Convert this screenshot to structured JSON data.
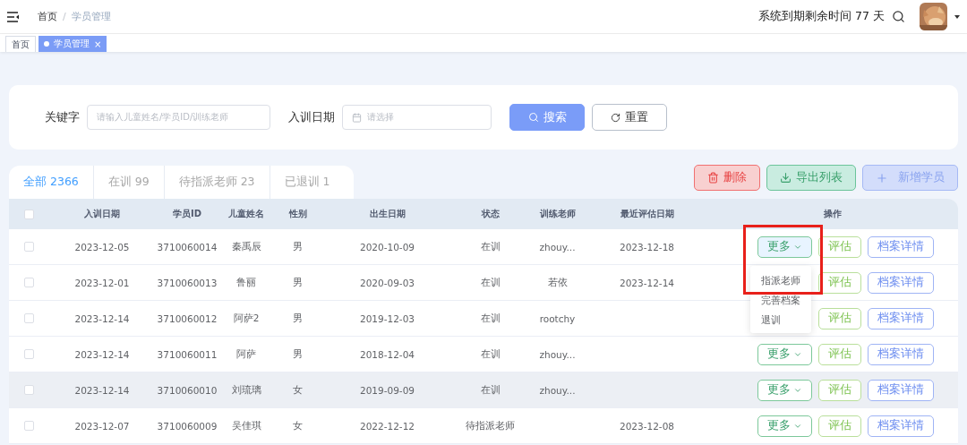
{
  "breadcrumb": [
    {
      "label": "首页",
      "current": false
    },
    {
      "label": "学员管理",
      "current": true
    }
  ],
  "breadcrumb_separator": "/",
  "expiry_notice": "系统到期剩余时间 77 天",
  "page_tabs": [
    {
      "label": "首页",
      "selected": false,
      "closable": false
    },
    {
      "label": "学员管理",
      "selected": true,
      "closable": true,
      "close": "×"
    }
  ],
  "search": {
    "fields": [
      {
        "label": "关键字",
        "placeholder": "请输入儿童姓名/学员ID/训练老师",
        "kind": "text"
      },
      {
        "label": "入训日期",
        "placeholder": "请选择",
        "kind": "date"
      }
    ],
    "buttons": [
      {
        "label": "搜索",
        "kind": "primary"
      },
      {
        "label": "重置",
        "kind": "default"
      }
    ]
  },
  "status_tabs": [
    {
      "label": "全部 2366",
      "selected": true
    },
    {
      "label": "在训 99",
      "selected": false
    },
    {
      "label": "待指派老师 23",
      "selected": false
    },
    {
      "label": "已退训 1",
      "selected": false
    }
  ],
  "toolbar": [
    {
      "label": "删除",
      "kind": "delete"
    },
    {
      "label": "导出列表",
      "kind": "export"
    },
    {
      "label": "新增学员",
      "kind": "add"
    }
  ],
  "annotation": {
    "kind": "highlight-frame"
  },
  "table": {
    "select_all_checked": false,
    "columns": [
      "入训日期",
      "学员ID",
      "儿童姓名",
      "性别",
      "出生日期",
      "状态",
      "训练老师",
      "最近评估日期",
      "操作"
    ],
    "rows": [
      {
        "cells": [
          "2023-12-05",
          "3710060014",
          "秦禹辰",
          "男",
          "2020-10-09",
          "在训",
          "zhouy...",
          "2023-12-18"
        ],
        "checked": false,
        "hovered": false,
        "actions": [
          {
            "label": "更多",
            "kind": "more",
            "open": true
          },
          {
            "label": "评估",
            "kind": "assess"
          },
          {
            "label": "档案详情",
            "kind": "detail"
          }
        ]
      },
      {
        "cells": [
          "2023-12-01",
          "3710060013",
          "鲁丽",
          "男",
          "2020-09-03",
          "在训",
          "若依",
          "2023-12-14"
        ],
        "checked": false,
        "hovered": false,
        "actions": [
          {
            "label": "评估",
            "kind": "assess"
          },
          {
            "label": "档案详情",
            "kind": "detail"
          }
        ]
      },
      {
        "cells": [
          "2023-12-14",
          "3710060012",
          "阿萨2",
          "男",
          "2019-12-03",
          "在训",
          "rootchy",
          ""
        ],
        "checked": false,
        "hovered": false,
        "actions": [
          {
            "label": "评估",
            "kind": "assess"
          },
          {
            "label": "档案详情",
            "kind": "detail"
          }
        ]
      },
      {
        "cells": [
          "2023-12-14",
          "3710060011",
          "阿萨",
          "男",
          "2018-12-04",
          "在训",
          "zhouy...",
          ""
        ],
        "checked": false,
        "hovered": false,
        "actions": [
          {
            "label": "更多",
            "kind": "more",
            "open": false
          },
          {
            "label": "评估",
            "kind": "assess"
          },
          {
            "label": "档案详情",
            "kind": "detail"
          }
        ]
      },
      {
        "cells": [
          "2023-12-14",
          "3710060010",
          "刘琉璃",
          "女",
          "2019-09-09",
          "在训",
          "zhouy...",
          ""
        ],
        "checked": false,
        "hovered": true,
        "actions": [
          {
            "label": "更多",
            "kind": "more",
            "open": false
          },
          {
            "label": "评估",
            "kind": "assess"
          },
          {
            "label": "档案详情",
            "kind": "detail"
          }
        ]
      },
      {
        "cells": [
          "2023-12-07",
          "3710060009",
          "吴佳琪",
          "女",
          "2022-12-12",
          "待指派老师",
          "",
          "2023-12-08"
        ],
        "checked": false,
        "hovered": false,
        "actions": [
          {
            "label": "更多",
            "kind": "more",
            "open": false
          },
          {
            "label": "评估",
            "kind": "assess"
          },
          {
            "label": "档案详情",
            "kind": "detail"
          }
        ]
      }
    ]
  },
  "more_menu": [
    "指派老师",
    "完善档案",
    "退训"
  ]
}
